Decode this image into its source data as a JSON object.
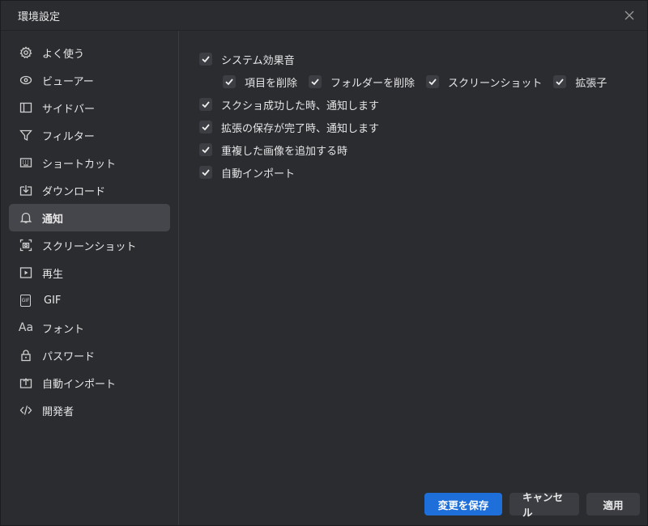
{
  "window": {
    "title": "環境設定"
  },
  "sidebar": {
    "items": [
      {
        "label": "よく使う",
        "icon": "gear-icon"
      },
      {
        "label": "ビューアー",
        "icon": "eye-icon"
      },
      {
        "label": "サイドバー",
        "icon": "sidebar-panel-icon"
      },
      {
        "label": "フィルター",
        "icon": "funnel-icon"
      },
      {
        "label": "ショートカット",
        "icon": "keyboard-icon"
      },
      {
        "label": "ダウンロード",
        "icon": "download-icon"
      },
      {
        "label": "通知",
        "icon": "bell-icon",
        "active": true
      },
      {
        "label": "スクリーンショット",
        "icon": "screenshot-icon"
      },
      {
        "label": "再生",
        "icon": "play-icon"
      },
      {
        "label": "GIF",
        "icon": "gif-icon",
        "icon_text": "GIF"
      },
      {
        "label": "フォント",
        "icon": "font-icon",
        "icon_text": "Aa"
      },
      {
        "label": "パスワード",
        "icon": "lock-icon"
      },
      {
        "label": "自動インポート",
        "icon": "import-icon"
      },
      {
        "label": "開発者",
        "icon": "code-icon"
      }
    ]
  },
  "notifications": {
    "system_sound": {
      "label": "システム効果音",
      "checked": true
    },
    "sub_options": [
      {
        "label": "項目を削除",
        "checked": true
      },
      {
        "label": "フォルダーを削除",
        "checked": true
      },
      {
        "label": "スクリーンショット",
        "checked": true
      },
      {
        "label": "拡張子",
        "checked": true
      }
    ],
    "options": [
      {
        "label": "スクショ成功した時、通知します",
        "checked": true
      },
      {
        "label": "拡張の保存が完了時、通知します",
        "checked": true
      },
      {
        "label": "重複した画像を追加する時",
        "checked": true
      },
      {
        "label": "自動インポート",
        "checked": true
      }
    ]
  },
  "footer": {
    "save_label": "変更を保存",
    "cancel_label": "キャンセル",
    "apply_label": "適用"
  },
  "colors": {
    "background": "#2b2c30",
    "accent": "#1e6fd9",
    "active_item": "#45464c",
    "checkbox": "#3d3e44"
  }
}
